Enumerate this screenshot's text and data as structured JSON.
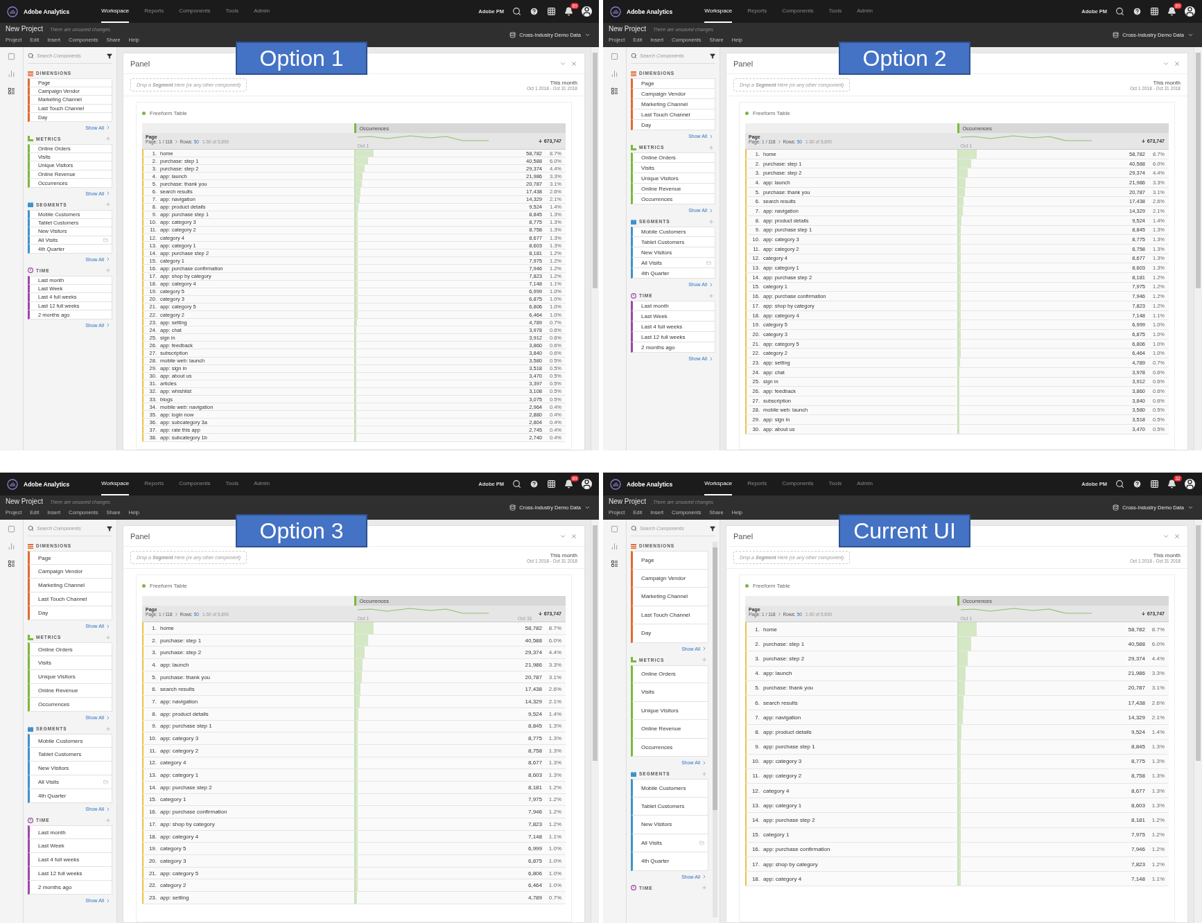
{
  "screens": [
    {
      "label": "Option 1",
      "kind": "compact",
      "nav": {
        "product": "Adobe Analytics",
        "tabs": [
          {
            "label": "Workspace",
            "selected": true
          },
          {
            "label": "Reports",
            "selected": false
          },
          {
            "label": "Components",
            "selected": false
          },
          {
            "label": "Tools",
            "selected": false
          },
          {
            "label": "Admin",
            "selected": false
          }
        ],
        "user": "Adobe PM",
        "badge": "89"
      },
      "project": {
        "title": "New Project",
        "status": "There are unsaved changes",
        "menu": [
          "Project",
          "Edit",
          "Insert",
          "Components",
          "Share",
          "Help"
        ],
        "suite": "Cross-Industry Demo Data"
      },
      "sidebar": {
        "search_placeholder": "Search Components",
        "sections": [
          {
            "kind": "dimensions",
            "title": "DIMENSIONS",
            "color": "#e2692f",
            "add": false,
            "items": [
              {
                "label": "Page",
                "shared": false
              },
              {
                "label": "Campaign Vendor",
                "shared": false
              },
              {
                "label": "Marketing Channel",
                "shared": false
              },
              {
                "label": "Last Touch Channel",
                "shared": false
              },
              {
                "label": "Day",
                "shared": false
              }
            ],
            "show_all": "Show All"
          },
          {
            "kind": "metrics",
            "title": "METRICS",
            "color": "#7ab83c",
            "add": true,
            "items": [
              {
                "label": "Online Orders",
                "shared": false
              },
              {
                "label": "Visits",
                "shared": false
              },
              {
                "label": "Unique Visitors",
                "shared": false
              },
              {
                "label": "Online Revenue",
                "shared": false
              },
              {
                "label": "Occurrences",
                "shared": false
              }
            ],
            "show_all": "Show All"
          },
          {
            "kind": "segments",
            "title": "SEGMENTS",
            "color": "#3d93cc",
            "add": true,
            "items": [
              {
                "label": "Mobile Customers",
                "shared": false
              },
              {
                "label": "Tablet Customers",
                "shared": false
              },
              {
                "label": "New Visitors",
                "shared": false
              },
              {
                "label": "All Visits",
                "shared": true
              },
              {
                "label": "4th Quarter",
                "shared": false
              }
            ],
            "show_all": "Show All"
          },
          {
            "kind": "time",
            "title": "TIME",
            "color": "#9c48a8",
            "add": true,
            "items": [
              {
                "label": "Last month",
                "shared": false
              },
              {
                "label": "Last Week",
                "shared": false
              },
              {
                "label": "Last 4 full weeks",
                "shared": false
              },
              {
                "label": "Last 12 full weeks",
                "shared": false
              },
              {
                "label": "2 months ago",
                "shared": false
              }
            ],
            "show_all": "Show All"
          }
        ]
      },
      "panel": {
        "title": "Panel",
        "drop_hint": "Drop a **Segment** Here (or any other component)",
        "range_title": "This month",
        "range": "Oct 1 2018 - Oct 31 2018"
      },
      "table": {
        "title": "Freeform Table",
        "metric": "Occurrences",
        "dimension": "Page",
        "pager": {
          "label": "Page:",
          "page": "1",
          "pages": "/ 118",
          "rows_label": "Rows:",
          "rows": "50",
          "range": "1-50 of 5,890"
        },
        "axis_start": "Oct 1",
        "total": "673,747",
        "rows": [
          {
            "n": "1.",
            "page": "home",
            "value": "58,782",
            "share": "8.7%",
            "level": 0.087
          },
          {
            "n": "2.",
            "page": "purchase: step 1",
            "value": "40,588",
            "share": "6.0%",
            "level": 0.06
          },
          {
            "n": "3.",
            "page": "purchase: step 2",
            "value": "29,374",
            "share": "4.4%",
            "level": 0.044
          },
          {
            "n": "4.",
            "page": "app: launch",
            "value": "21,986",
            "share": "3.3%",
            "level": 0.033
          },
          {
            "n": "5.",
            "page": "purchase: thank you",
            "value": "20,787",
            "share": "3.1%",
            "level": 0.031
          },
          {
            "n": "6.",
            "page": "search results",
            "value": "17,438",
            "share": "2.6%",
            "level": 0.026
          },
          {
            "n": "7.",
            "page": "app: navigation",
            "value": "14,329",
            "share": "2.1%",
            "level": 0.021
          },
          {
            "n": "8.",
            "page": "app: product details",
            "value": "9,524",
            "share": "1.4%",
            "level": 0.014
          },
          {
            "n": "9.",
            "page": "app: purchase step 1",
            "value": "8,845",
            "share": "1.3%",
            "level": 0.013
          },
          {
            "n": "10.",
            "page": "app: category 3",
            "value": "8,775",
            "share": "1.3%",
            "level": 0.013
          },
          {
            "n": "11.",
            "page": "app: category 2",
            "value": "8,758",
            "share": "1.3%",
            "level": 0.013
          },
          {
            "n": "12.",
            "page": "category 4",
            "value": "8,677",
            "share": "1.3%",
            "level": 0.013
          },
          {
            "n": "13.",
            "page": "app: category 1",
            "value": "8,603",
            "share": "1.3%",
            "level": 0.013
          },
          {
            "n": "14.",
            "page": "app: purchase step 2",
            "value": "8,181",
            "share": "1.2%",
            "level": 0.012
          },
          {
            "n": "15.",
            "page": "category 1",
            "value": "7,975",
            "share": "1.2%",
            "level": 0.012
          },
          {
            "n": "16.",
            "page": "app: purchase confirmation",
            "value": "7,946",
            "share": "1.2%",
            "level": 0.012
          },
          {
            "n": "17.",
            "page": "app: shop by category",
            "value": "7,823",
            "share": "1.2%",
            "level": 0.012
          },
          {
            "n": "18.",
            "page": "app: category 4",
            "value": "7,148",
            "share": "1.1%",
            "level": 0.011
          },
          {
            "n": "19.",
            "page": "category 5",
            "value": "6,999",
            "share": "1.0%",
            "level": 0.01
          },
          {
            "n": "20.",
            "page": "category 3",
            "value": "6,875",
            "share": "1.0%",
            "level": 0.01
          },
          {
            "n": "21.",
            "page": "app: category 5",
            "value": "6,806",
            "share": "1.0%",
            "level": 0.01
          },
          {
            "n": "22.",
            "page": "category 2",
            "value": "6,464",
            "share": "1.0%",
            "level": 0.01
          },
          {
            "n": "23.",
            "page": "app: setting",
            "value": "4,789",
            "share": "0.7%",
            "level": 0.007
          },
          {
            "n": "24.",
            "page": "app: chat",
            "value": "3,978",
            "share": "0.6%",
            "level": 0.006
          },
          {
            "n": "25.",
            "page": "sign in",
            "value": "3,912",
            "share": "0.6%",
            "level": 0.006
          },
          {
            "n": "26.",
            "page": "app: feedback",
            "value": "3,860",
            "share": "0.6%",
            "level": 0.006
          },
          {
            "n": "27.",
            "page": "subscription",
            "value": "3,840",
            "share": "0.6%",
            "level": 0.006
          },
          {
            "n": "28.",
            "page": "mobile web: launch",
            "value": "3,580",
            "share": "0.5%",
            "level": 0.005
          },
          {
            "n": "29.",
            "page": "app: sign in",
            "value": "3,518",
            "share": "0.5%",
            "level": 0.005
          },
          {
            "n": "30.",
            "page": "app: about us",
            "value": "3,470",
            "share": "0.5%",
            "level": 0.005
          },
          {
            "n": "31.",
            "page": "articles",
            "value": "3,397",
            "share": "0.5%",
            "level": 0.005
          },
          {
            "n": "32.",
            "page": "app: whishlist",
            "value": "3,108",
            "share": "0.5%",
            "level": 0.005
          },
          {
            "n": "33.",
            "page": "blogs",
            "value": "3,075",
            "share": "0.5%",
            "level": 0.005
          },
          {
            "n": "34.",
            "page": "mobile web: navigation",
            "value": "2,964",
            "share": "0.4%",
            "level": 0.004
          },
          {
            "n": "35.",
            "page": "app: login now",
            "value": "2,880",
            "share": "0.4%",
            "level": 0.004
          },
          {
            "n": "36.",
            "page": "app: subcategory 3a",
            "value": "2,804",
            "share": "0.4%",
            "level": 0.004
          },
          {
            "n": "37.",
            "page": "app: rate this app",
            "value": "2,745",
            "share": "0.4%",
            "level": 0.004
          },
          {
            "n": "38.",
            "page": "app: subcategory 1b",
            "value": "2,740",
            "share": "0.4%",
            "level": 0.004
          }
        ]
      }
    },
    {
      "label": "Option 2",
      "kind": "medium",
      "nav": {
        "product": "Adobe Analytics",
        "tabs": [
          {
            "label": "Workspace",
            "selected": true
          },
          {
            "label": "Reports",
            "selected": false
          },
          {
            "label": "Components",
            "selected": false
          },
          {
            "label": "Tools",
            "selected": false
          },
          {
            "label": "Admin",
            "selected": false
          }
        ],
        "user": "Adobe PM",
        "badge": "89"
      },
      "project": {
        "title": "New Project",
        "status": "There are unsaved changes",
        "menu": [
          "Project",
          "Edit",
          "Insert",
          "Components",
          "Share",
          "Help"
        ],
        "suite": "Cross-Industry Demo Data"
      },
      "sidebar": {
        "search_placeholder": "Search Components",
        "sections": [
          {
            "kind": "dimensions",
            "title": "DIMENSIONS",
            "color": "#e2692f",
            "add": false,
            "items": [
              {
                "label": "Page",
                "shared": false
              },
              {
                "label": "Campaign Vendor",
                "shared": false
              },
              {
                "label": "Marketing Channel",
                "shared": false
              },
              {
                "label": "Last Touch Channel",
                "shared": false
              },
              {
                "label": "Day",
                "shared": false
              }
            ],
            "show_all": "Show All"
          },
          {
            "kind": "metrics",
            "title": "METRICS",
            "color": "#7ab83c",
            "add": true,
            "items": [
              {
                "label": "Online Orders",
                "shared": false
              },
              {
                "label": "Visits",
                "shared": false
              },
              {
                "label": "Unique Visitors",
                "shared": false
              },
              {
                "label": "Online Revenue",
                "shared": false
              },
              {
                "label": "Occurrences",
                "shared": false
              }
            ],
            "show_all": "Show All"
          },
          {
            "kind": "segments",
            "title": "SEGMENTS",
            "color": "#3d93cc",
            "add": true,
            "items": [
              {
                "label": "Mobile Customers",
                "shared": false
              },
              {
                "label": "Tablet Customers",
                "shared": false
              },
              {
                "label": "New Visitors",
                "shared": false
              },
              {
                "label": "All Visits",
                "shared": true
              },
              {
                "label": "4th Quarter",
                "shared": false
              }
            ],
            "show_all": "Show All"
          },
          {
            "kind": "time",
            "title": "TIME",
            "color": "#9c48a8",
            "add": true,
            "items": [
              {
                "label": "Last month",
                "shared": false
              },
              {
                "label": "Last Week",
                "shared": false
              },
              {
                "label": "Last 4 full weeks",
                "shared": false
              },
              {
                "label": "Last 12 full weeks",
                "shared": false
              },
              {
                "label": "2 months ago",
                "shared": false
              }
            ],
            "show_all": "Show All"
          }
        ]
      },
      "panel": {
        "title": "Panel",
        "drop_hint": "Drop a **Segment** Here (or any other component)",
        "range_title": "This month",
        "range": "Oct 1 2018 - Oct 31 2018"
      },
      "table": {
        "title": "Freeform Table",
        "metric": "Occurrences",
        "dimension": "Page",
        "pager": {
          "label": "Page:",
          "page": "1",
          "pages": "/ 118",
          "rows_label": "Rows:",
          "rows": "50",
          "range": "1-50 of 5,890"
        },
        "axis_start": "Oct 1",
        "total": "673,747",
        "rows": [
          {
            "n": "1.",
            "page": "home",
            "value": "58,782",
            "share": "8.7%",
            "level": 0.087
          },
          {
            "n": "2.",
            "page": "purchase: step 1",
            "value": "40,588",
            "share": "6.0%",
            "level": 0.06
          },
          {
            "n": "3.",
            "page": "purchase: step 2",
            "value": "29,374",
            "share": "4.4%",
            "level": 0.044
          },
          {
            "n": "4.",
            "page": "app: launch",
            "value": "21,986",
            "share": "3.3%",
            "level": 0.033
          },
          {
            "n": "5.",
            "page": "purchase: thank you",
            "value": "20,787",
            "share": "3.1%",
            "level": 0.031
          },
          {
            "n": "6.",
            "page": "search results",
            "value": "17,438",
            "share": "2.6%",
            "level": 0.026
          },
          {
            "n": "7.",
            "page": "app: navigation",
            "value": "14,329",
            "share": "2.1%",
            "level": 0.021
          },
          {
            "n": "8.",
            "page": "app: product details",
            "value": "9,524",
            "share": "1.4%",
            "level": 0.014
          },
          {
            "n": "9.",
            "page": "app: purchase step 1",
            "value": "8,845",
            "share": "1.3%",
            "level": 0.013
          },
          {
            "n": "10.",
            "page": "app: category 3",
            "value": "8,775",
            "share": "1.3%",
            "level": 0.013
          },
          {
            "n": "11.",
            "page": "app: category 2",
            "value": "8,758",
            "share": "1.3%",
            "level": 0.013
          },
          {
            "n": "12.",
            "page": "category 4",
            "value": "8,677",
            "share": "1.3%",
            "level": 0.013
          },
          {
            "n": "13.",
            "page": "app: category 1",
            "value": "8,603",
            "share": "1.3%",
            "level": 0.013
          },
          {
            "n": "14.",
            "page": "app: purchase step 2",
            "value": "8,181",
            "share": "1.2%",
            "level": 0.012
          },
          {
            "n": "15.",
            "page": "category 1",
            "value": "7,975",
            "share": "1.2%",
            "level": 0.012
          },
          {
            "n": "16.",
            "page": "app: purchase confirmation",
            "value": "7,946",
            "share": "1.2%",
            "level": 0.012
          },
          {
            "n": "17.",
            "page": "app: shop by category",
            "value": "7,823",
            "share": "1.2%",
            "level": 0.012
          },
          {
            "n": "18.",
            "page": "app: category 4",
            "value": "7,148",
            "share": "1.1%",
            "level": 0.011
          },
          {
            "n": "19.",
            "page": "category 5",
            "value": "6,999",
            "share": "1.0%",
            "level": 0.01
          },
          {
            "n": "20.",
            "page": "category 3",
            "value": "6,875",
            "share": "1.0%",
            "level": 0.01
          },
          {
            "n": "21.",
            "page": "app: category 5",
            "value": "6,806",
            "share": "1.0%",
            "level": 0.01
          },
          {
            "n": "22.",
            "page": "category 2",
            "value": "6,464",
            "share": "1.0%",
            "level": 0.01
          },
          {
            "n": "23.",
            "page": "app: setting",
            "value": "4,789",
            "share": "0.7%",
            "level": 0.007
          },
          {
            "n": "24.",
            "page": "app: chat",
            "value": "3,978",
            "share": "0.6%",
            "level": 0.006
          },
          {
            "n": "25.",
            "page": "sign in",
            "value": "3,912",
            "share": "0.6%",
            "level": 0.006
          },
          {
            "n": "26.",
            "page": "app: feedback",
            "value": "3,860",
            "share": "0.6%",
            "level": 0.006
          },
          {
            "n": "27.",
            "page": "subscription",
            "value": "3,840",
            "share": "0.6%",
            "level": 0.006
          },
          {
            "n": "28.",
            "page": "mobile web: launch",
            "value": "3,580",
            "share": "0.5%",
            "level": 0.005
          },
          {
            "n": "29.",
            "page": "app: sign in",
            "value": "3,518",
            "share": "0.5%",
            "level": 0.005
          },
          {
            "n": "30.",
            "page": "app: about us",
            "value": "3,470",
            "share": "0.5%",
            "level": 0.005
          }
        ]
      }
    },
    {
      "label": "Option 3",
      "kind": "roomy",
      "nav": {
        "product": "Adobe Analytics",
        "tabs": [
          {
            "label": "Workspace",
            "selected": true
          },
          {
            "label": "Reports",
            "selected": false
          },
          {
            "label": "Components",
            "selected": false
          },
          {
            "label": "Tools",
            "selected": false
          },
          {
            "label": "Admin",
            "selected": false
          }
        ],
        "user": "Adobe PM",
        "badge": "89"
      },
      "project": {
        "title": "New Project",
        "status": "There are unsaved changes",
        "menu": [
          "Project",
          "Edit",
          "Insert",
          "Components",
          "Share",
          "Help"
        ],
        "suite": "Cross-Industry Demo Data"
      },
      "sidebar": {
        "search_placeholder": "Search Components",
        "sections": [
          {
            "kind": "dimensions",
            "title": "DIMENSIONS",
            "color": "#e2692f",
            "add": false,
            "items": [
              {
                "label": "Page",
                "shared": false
              },
              {
                "label": "Campaign Vendor",
                "shared": false
              },
              {
                "label": "Marketing Channel",
                "shared": false
              },
              {
                "label": "Last Touch Channel",
                "shared": false
              },
              {
                "label": "Day",
                "shared": false
              }
            ],
            "show_all": "Show All"
          },
          {
            "kind": "metrics",
            "title": "METRICS",
            "color": "#7ab83c",
            "add": true,
            "items": [
              {
                "label": "Online Orders",
                "shared": false
              },
              {
                "label": "Visits",
                "shared": false
              },
              {
                "label": "Unique Visitors",
                "shared": false
              },
              {
                "label": "Online Revenue",
                "shared": false
              },
              {
                "label": "Occurrences",
                "shared": false
              }
            ],
            "show_all": "Show All"
          },
          {
            "kind": "segments",
            "title": "SEGMENTS",
            "color": "#3d93cc",
            "add": true,
            "items": [
              {
                "label": "Mobile Customers",
                "shared": false
              },
              {
                "label": "Tablet Customers",
                "shared": false
              },
              {
                "label": "New Visitors",
                "shared": false
              },
              {
                "label": "All Visits",
                "shared": true
              },
              {
                "label": "4th Quarter",
                "shared": false
              }
            ],
            "show_all": "Show All"
          },
          {
            "kind": "time",
            "title": "TIME",
            "color": "#9c48a8",
            "add": true,
            "items": [
              {
                "label": "Last month",
                "shared": false
              },
              {
                "label": "Last Week",
                "shared": false
              },
              {
                "label": "Last 4 full weeks",
                "shared": false
              },
              {
                "label": "Last 12 full weeks",
                "shared": false
              },
              {
                "label": "2 months ago",
                "shared": false
              }
            ],
            "show_all": "Show All"
          }
        ]
      },
      "panel": {
        "title": "Panel",
        "drop_hint": "Drop a **Segment** Here (or any other component)",
        "range_title": "This month",
        "range": "Oct 1 2018 - Oct 31 2018"
      },
      "table": {
        "title": "Freeform Table",
        "metric": "Occurrences",
        "dimension": "Page",
        "pager": {
          "label": "Page:",
          "page": "1",
          "pages": "/ 118",
          "rows_label": "Rows:",
          "rows": "50",
          "range": "1-50 of 5,890"
        },
        "axis_start": "Oct 1",
        "axis_end": "Oct 31",
        "total": "673,747",
        "rows": [
          {
            "n": "1.",
            "page": "home",
            "value": "58,782",
            "share": "8.7%",
            "level": 0.087
          },
          {
            "n": "2.",
            "page": "purchase: step 1",
            "value": "40,588",
            "share": "6.0%",
            "level": 0.06
          },
          {
            "n": "3.",
            "page": "purchase: step 2",
            "value": "29,374",
            "share": "4.4%",
            "level": 0.044
          },
          {
            "n": "4.",
            "page": "app: launch",
            "value": "21,986",
            "share": "3.3%",
            "level": 0.033
          },
          {
            "n": "5.",
            "page": "purchase: thank you",
            "value": "20,787",
            "share": "3.1%",
            "level": 0.031
          },
          {
            "n": "6.",
            "page": "search results",
            "value": "17,438",
            "share": "2.6%",
            "level": 0.026
          },
          {
            "n": "7.",
            "page": "app: navigation",
            "value": "14,329",
            "share": "2.1%",
            "level": 0.021
          },
          {
            "n": "8.",
            "page": "app: product details",
            "value": "9,524",
            "share": "1.4%",
            "level": 0.014
          },
          {
            "n": "9.",
            "page": "app: purchase step 1",
            "value": "8,845",
            "share": "1.3%",
            "level": 0.013
          },
          {
            "n": "10.",
            "page": "app: category 3",
            "value": "8,775",
            "share": "1.3%",
            "level": 0.013
          },
          {
            "n": "11.",
            "page": "app: category 2",
            "value": "8,758",
            "share": "1.3%",
            "level": 0.013
          },
          {
            "n": "12.",
            "page": "category 4",
            "value": "8,677",
            "share": "1.3%",
            "level": 0.013
          },
          {
            "n": "13.",
            "page": "app: category 1",
            "value": "8,603",
            "share": "1.3%",
            "level": 0.013
          },
          {
            "n": "14.",
            "page": "app: purchase step 2",
            "value": "8,181",
            "share": "1.2%",
            "level": 0.012
          },
          {
            "n": "15.",
            "page": "category 1",
            "value": "7,975",
            "share": "1.2%",
            "level": 0.012
          },
          {
            "n": "16.",
            "page": "app: purchase confirmation",
            "value": "7,946",
            "share": "1.2%",
            "level": 0.012
          },
          {
            "n": "17.",
            "page": "app: shop by category",
            "value": "7,823",
            "share": "1.2%",
            "level": 0.012
          },
          {
            "n": "18.",
            "page": "app: category 4",
            "value": "7,148",
            "share": "1.1%",
            "level": 0.011
          },
          {
            "n": "19.",
            "page": "category 5",
            "value": "6,999",
            "share": "1.0%",
            "level": 0.01
          },
          {
            "n": "20.",
            "page": "category 3",
            "value": "6,875",
            "share": "1.0%",
            "level": 0.01
          },
          {
            "n": "21.",
            "page": "app: category 5",
            "value": "6,806",
            "share": "1.0%",
            "level": 0.01
          },
          {
            "n": "22.",
            "page": "category 2",
            "value": "6,464",
            "share": "1.0%",
            "level": 0.01
          },
          {
            "n": "23.",
            "page": "app: setting",
            "value": "4,789",
            "share": "0.7%",
            "level": 0.007
          }
        ]
      }
    },
    {
      "label": "Current UI",
      "kind": "spacious",
      "nav": {
        "product": "Adobe Analytics",
        "tabs": [
          {
            "label": "Workspace",
            "selected": true
          },
          {
            "label": "Reports",
            "selected": false
          },
          {
            "label": "Components",
            "selected": false
          },
          {
            "label": "Tools",
            "selected": false
          },
          {
            "label": "Admin",
            "selected": false
          }
        ],
        "user": "Adobe PM",
        "badge": "32"
      },
      "project": {
        "title": "New Project",
        "status": "There are unsaved changes",
        "menu": [
          "Project",
          "Edit",
          "Insert",
          "Components",
          "Share",
          "Help"
        ],
        "suite": "Cross-Industry Demo Data"
      },
      "sidebar": {
        "search_placeholder": "Search Components",
        "sections": [
          {
            "kind": "dimensions",
            "title": "DIMENSIONS",
            "color": "#e2692f",
            "add": false,
            "items": [
              {
                "label": "Page",
                "shared": false
              },
              {
                "label": "Campaign Vendor",
                "shared": false
              },
              {
                "label": "Marketing Channel",
                "shared": false
              },
              {
                "label": "Last Touch Channel",
                "shared": false
              },
              {
                "label": "Day",
                "shared": false
              }
            ],
            "show_all": "Show All"
          },
          {
            "kind": "metrics",
            "title": "METRICS",
            "color": "#7ab83c",
            "add": true,
            "items": [
              {
                "label": "Online Orders",
                "shared": false
              },
              {
                "label": "Visits",
                "shared": false
              },
              {
                "label": "Unique Visitors",
                "shared": false
              },
              {
                "label": "Online Revenue",
                "shared": false
              },
              {
                "label": "Occurrences",
                "shared": false
              }
            ],
            "show_all": "Show All"
          },
          {
            "kind": "segments",
            "title": "SEGMENTS",
            "color": "#3d93cc",
            "add": true,
            "items": [
              {
                "label": "Mobile Customers",
                "shared": false
              },
              {
                "label": "Tablet Customers",
                "shared": false
              },
              {
                "label": "New Visitors",
                "shared": false
              },
              {
                "label": "All Visits",
                "shared": true
              },
              {
                "label": "4th Quarter",
                "shared": false
              }
            ],
            "show_all": "Show All"
          },
          {
            "kind": "time",
            "title": "TIME",
            "color": "#9c48a8",
            "add": true
          }
        ]
      },
      "panel": {
        "title": "Panel",
        "drop_hint": "Drop a **Segment** Here (or any other component)",
        "range_title": "This month",
        "range": "Oct 1 2018 - Oct 31 2018"
      },
      "table": {
        "title": "Freeform Table",
        "metric": "Occurrences",
        "dimension": "Page",
        "pager": {
          "label": "Page:",
          "page": "1",
          "pages": "/ 118",
          "rows_label": "Rows:",
          "rows": "50",
          "range": "1-50 of 5,890"
        },
        "axis_start": "Oct 1",
        "total": "673,747",
        "rows": [
          {
            "n": "1.",
            "page": "home",
            "value": "58,782",
            "share": "8.7%",
            "level": 0.087
          },
          {
            "n": "2.",
            "page": "purchase: step 1",
            "value": "40,588",
            "share": "6.0%",
            "level": 0.06
          },
          {
            "n": "3.",
            "page": "purchase: step 2",
            "value": "29,374",
            "share": "4.4%",
            "level": 0.044
          },
          {
            "n": "4.",
            "page": "app: launch",
            "value": "21,986",
            "share": "3.3%",
            "level": 0.033
          },
          {
            "n": "5.",
            "page": "purchase: thank you",
            "value": "20,787",
            "share": "3.1%",
            "level": 0.031
          },
          {
            "n": "6.",
            "page": "search results",
            "value": "17,438",
            "share": "2.6%",
            "level": 0.026
          },
          {
            "n": "7.",
            "page": "app: navigation",
            "value": "14,329",
            "share": "2.1%",
            "level": 0.021
          },
          {
            "n": "8.",
            "page": "app: product details",
            "value": "9,524",
            "share": "1.4%",
            "level": 0.014
          },
          {
            "n": "9.",
            "page": "app: purchase step 1",
            "value": "8,845",
            "share": "1.3%",
            "level": 0.013
          },
          {
            "n": "10.",
            "page": "app: category 3",
            "value": "8,775",
            "share": "1.3%",
            "level": 0.013
          },
          {
            "n": "11.",
            "page": "app: category 2",
            "value": "8,758",
            "share": "1.3%",
            "level": 0.013
          },
          {
            "n": "12.",
            "page": "category 4",
            "value": "8,677",
            "share": "1.3%",
            "level": 0.013
          },
          {
            "n": "13.",
            "page": "app: category 1",
            "value": "8,603",
            "share": "1.3%",
            "level": 0.013
          },
          {
            "n": "14.",
            "page": "app: purchase step 2",
            "value": "8,181",
            "share": "1.2%",
            "level": 0.012
          },
          {
            "n": "15.",
            "page": "category 1",
            "value": "7,975",
            "share": "1.2%",
            "level": 0.012
          },
          {
            "n": "16.",
            "page": "app: purchase confirmation",
            "value": "7,946",
            "share": "1.2%",
            "level": 0.012
          },
          {
            "n": "17.",
            "page": "app: shop by category",
            "value": "7,823",
            "share": "1.2%",
            "level": 0.012
          },
          {
            "n": "18.",
            "page": "app: category 4",
            "value": "7,148",
            "share": "1.1%",
            "level": 0.011
          }
        ]
      }
    }
  ]
}
